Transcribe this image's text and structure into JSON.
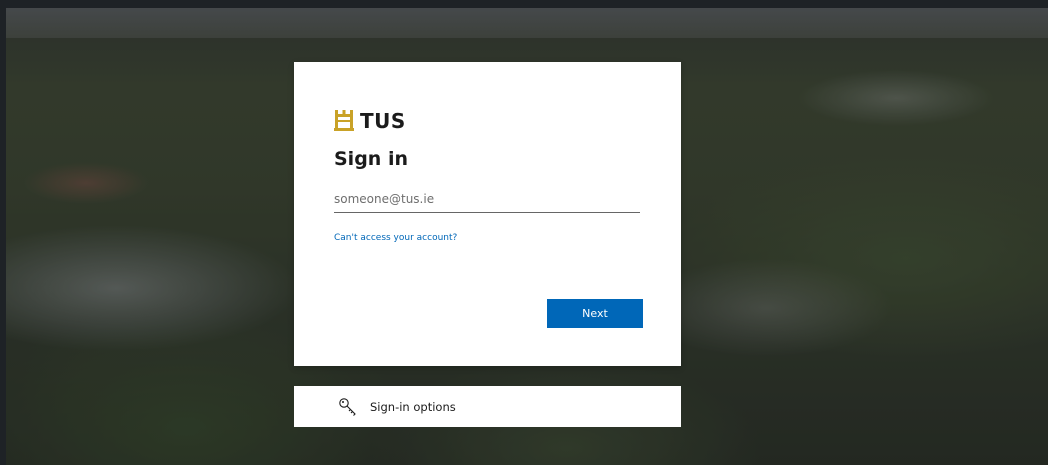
{
  "background": {
    "description_icon": "campus-aerial-photo",
    "overlay_color": "#000000"
  },
  "brand": {
    "name": "TUS",
    "logo_icon": "tus-crest-icon",
    "accent": "#c9a227"
  },
  "signin": {
    "title": "Sign in",
    "email_placeholder": "someone@tus.ie",
    "email_value": "",
    "cant_access_label": "Can't access your account?",
    "next_label": "Next"
  },
  "options": {
    "label": "Sign-in options",
    "icon": "key-icon"
  },
  "colors": {
    "primary_button": "#0067b8",
    "link": "#0067b8",
    "card_bg": "#ffffff",
    "text": "#1b1b1b"
  }
}
